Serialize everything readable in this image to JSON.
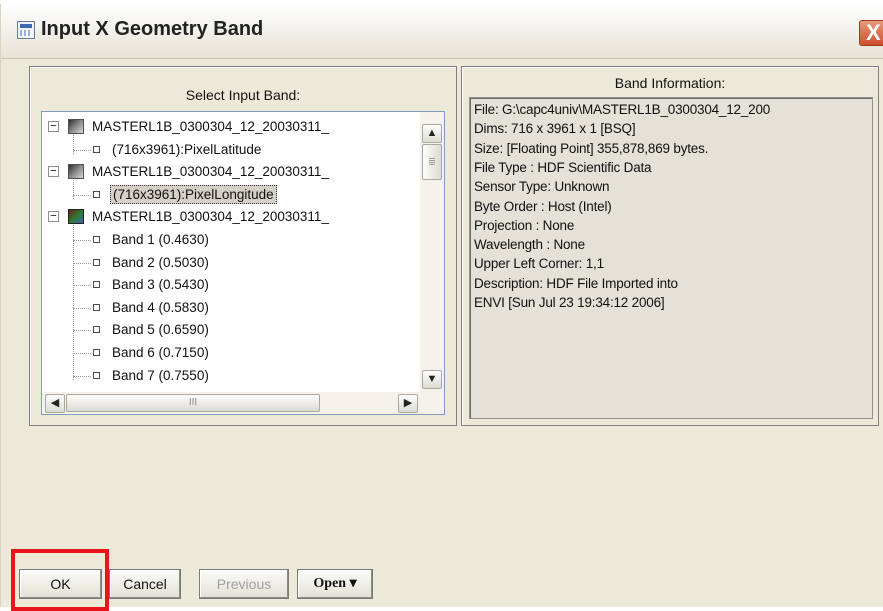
{
  "window": {
    "title": "Input X Geometry Band",
    "close_glyph": "X"
  },
  "select_panel": {
    "label": "Select Input Band:",
    "tree": [
      {
        "kind": "parent",
        "expander": "−",
        "icon": "grayscale-image-icon",
        "text": "MASTERL1B_0300304_12_20030311_"
      },
      {
        "kind": "leaf",
        "text": "(716x3961):PixelLatitude"
      },
      {
        "kind": "parent",
        "expander": "−",
        "icon": "grayscale-image-icon",
        "text": "MASTERL1B_0300304_12_20030311_"
      },
      {
        "kind": "leaf",
        "text": "(716x3961):PixelLongitude",
        "selected": true
      },
      {
        "kind": "parent",
        "expander": "−",
        "icon": "multiband-image-icon",
        "text": "MASTERL1B_0300304_12_20030311_"
      },
      {
        "kind": "leaf",
        "text": "Band 1 (0.4630)"
      },
      {
        "kind": "leaf",
        "text": "Band 2 (0.5030)"
      },
      {
        "kind": "leaf",
        "text": "Band 3 (0.5430)"
      },
      {
        "kind": "leaf",
        "text": "Band 4 (0.5830)"
      },
      {
        "kind": "leaf",
        "text": "Band 5 (0.6590)"
      },
      {
        "kind": "leaf",
        "text": "Band 6 (0.7150)"
      },
      {
        "kind": "leaf",
        "text": "Band 7 (0.7550)"
      }
    ],
    "scroll": {
      "up_glyph": "▲",
      "down_glyph": "▼",
      "left_glyph": "◀",
      "right_glyph": "▶",
      "hthumb_grip": "III"
    }
  },
  "info_panel": {
    "label": "Band Information:",
    "lines": [
      "File: G:\\capc4univ\\MASTERL1B_0300304_12_200",
      "Dims: 716 x 3961 x 1 [BSQ]",
      "Size: [Floating Point] 355,878,869 bytes.",
      "File Type  : HDF Scientific Data",
      "Sensor Type: Unknown",
      "Byte Order : Host (Intel)",
      "Projection : None",
      "Wavelength : None",
      "Upper Left Corner: 1,1",
      "Description: HDF File Imported into",
      "ENVI [Sun Jul 23 19:34:12 2006]"
    ]
  },
  "buttons": {
    "ok": "OK",
    "cancel": "Cancel",
    "previous": "Previous",
    "open": "Open ▾"
  },
  "colors": {
    "highlight_box": "#e8141c",
    "dialog_background": "#ece9d8",
    "info_background": "#e3e1d8"
  }
}
